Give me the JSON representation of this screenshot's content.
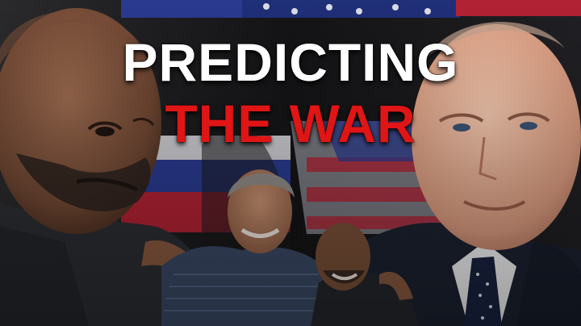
{
  "thumbnail": {
    "headline_line1": "PREDICTING",
    "headline_line2": "THE WAR",
    "colors": {
      "headline_primary": "#ffffff",
      "headline_accent": "#e01515",
      "flag_red": "#b22234",
      "flag_blue": "#2a3a8f",
      "background": "#121214"
    },
    "elements": [
      "bald-man-portrait",
      "world-leader-portrait",
      "two-men-group-photo",
      "us-flag-background",
      "russian-flag-background"
    ]
  }
}
